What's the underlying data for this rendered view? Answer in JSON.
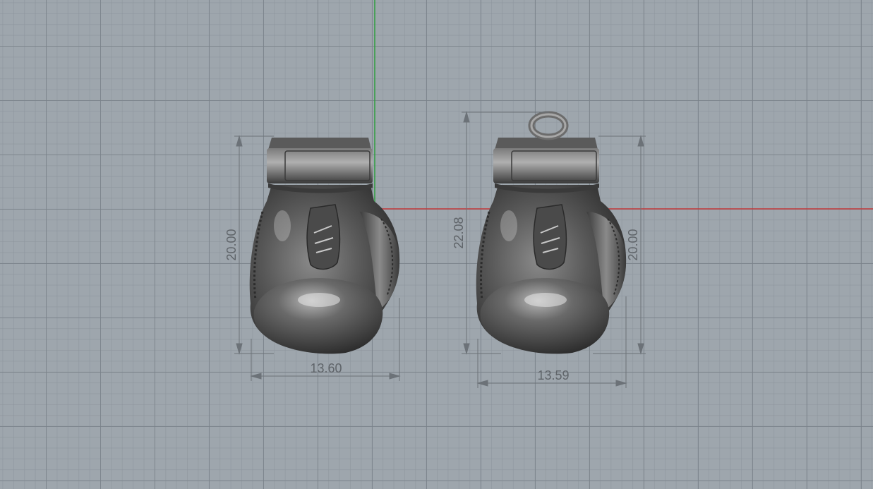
{
  "viewport": {
    "background": "#9ea6ad",
    "axis_x_color": "#c0393b",
    "axis_y_color": "#2e9e3e"
  },
  "dimensions": {
    "left_height": "20.00",
    "left_width": "13.60",
    "right_total_height": "22.08",
    "right_height": "20.00",
    "right_width": "13.59"
  },
  "objects": {
    "left_model": "boxing-glove",
    "right_model": "boxing-glove-pendant"
  }
}
